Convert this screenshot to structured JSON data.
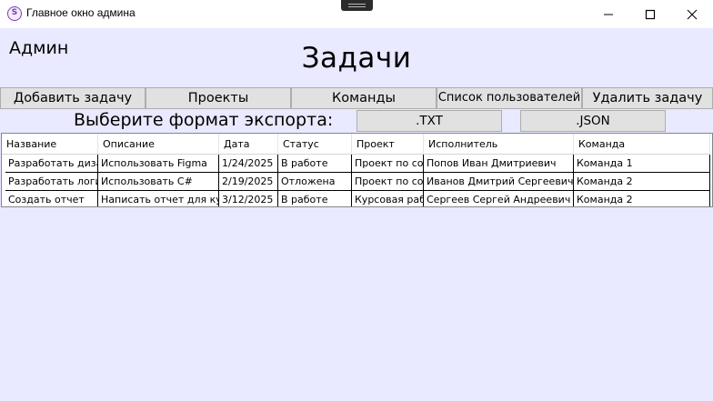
{
  "window": {
    "title": "Главное окно админа",
    "icon": "app-logo-icon",
    "controls": [
      "minimize-icon",
      "maximize-icon",
      "close-icon"
    ]
  },
  "header": {
    "role": "Админ",
    "title": "Задачи"
  },
  "nav": {
    "add_task": "Добавить задачу",
    "projects": "Проекты",
    "teams": "Команды",
    "users_list": "Список пользователей",
    "delete_task": "Удалить задачу"
  },
  "export": {
    "label": "Выберите формат экспорта:",
    "txt": ".TXT",
    "json": ".JSON"
  },
  "table": {
    "columns": [
      "Название",
      "Описание",
      "Дата",
      "Статус",
      "Проект",
      "Исполнитель",
      "Команда"
    ],
    "rows": [
      [
        "Разработать дизайн",
        "Использовать Figma",
        "1/24/2025",
        "В работе",
        "Проект по созданию",
        "Попов Иван Дмитриевич",
        "Команда 1"
      ],
      [
        "Разработать логику",
        "Использовать C#",
        "2/19/2025",
        "Отложена",
        "Проект по созданию",
        "Иванов Дмитрий Сергеевич",
        "Команда 2"
      ],
      [
        "Создать отчет",
        "Написать отчет для курсовой",
        "3/12/2025",
        "В работе",
        "Курсовая работа",
        "Сергеев Сергей Андреевич",
        "Команда 2"
      ]
    ]
  },
  "colors": {
    "background": "#e9e9ff",
    "button": "#e1e1e1",
    "accent": "#7b3fb5"
  }
}
